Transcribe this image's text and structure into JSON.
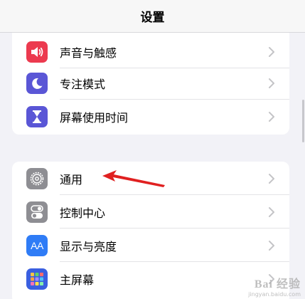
{
  "nav": {
    "title": "设置"
  },
  "group1": {
    "items": [
      {
        "label": "声音与触感",
        "icon": "speaker-icon",
        "color": "#ec3a4f"
      },
      {
        "label": "专注模式",
        "icon": "moon-icon",
        "color": "#5a56d6"
      },
      {
        "label": "屏幕使用时间",
        "icon": "hourglass-icon",
        "color": "#5a56d6"
      }
    ]
  },
  "group2": {
    "items": [
      {
        "label": "通用",
        "icon": "gear-icon",
        "color": "#8e8e93"
      },
      {
        "label": "控制中心",
        "icon": "toggles-icon",
        "color": "#8e8e93"
      },
      {
        "label": "显示与亮度",
        "icon": "text-size-icon",
        "color": "#2f7cf6",
        "icon_text": "AA"
      },
      {
        "label": "主屏幕",
        "icon": "home-grid-icon",
        "color": "#3a5fe0"
      }
    ]
  },
  "watermark": {
    "main": "Bai 经验",
    "sub": "jingyan.baidu.com"
  },
  "colors": {
    "background": "#f2f2f7",
    "chevron": "#c4c4c7",
    "arrow": "#e02020"
  }
}
